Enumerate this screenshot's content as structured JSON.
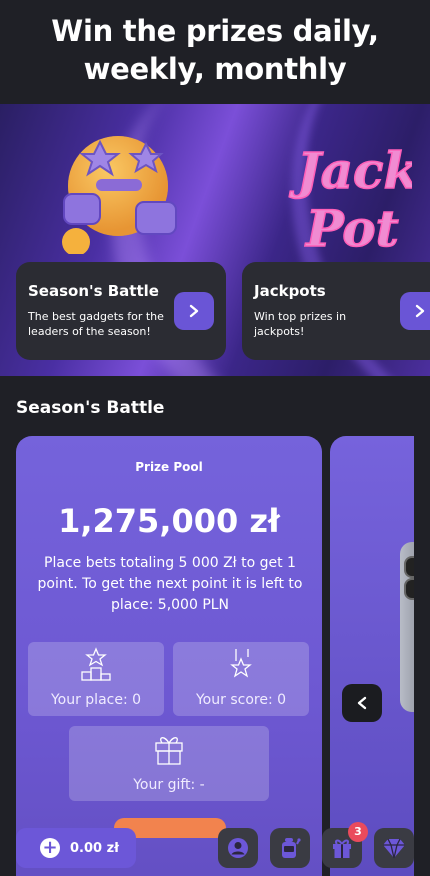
{
  "header": {
    "title": "Win the prizes daily, weekly, monthly"
  },
  "promos": [
    {
      "title": "Season's Battle",
      "description": "The best gadgets for the leaders of the season!",
      "icon": "chevron-right-icon"
    },
    {
      "title": "Jackpots",
      "description": "Win top prizes in jackpots!",
      "icon": "chevron-right-icon",
      "art_text": "Jack Pot"
    }
  ],
  "battle": {
    "heading": "Season's Battle",
    "prize_pool_label": "Prize Pool",
    "prize_amount": "1,275,000 zł",
    "description": "Place bets totaling 5 000 Zł to get 1 point. To get the next point it is left to place: 5,000 PLN",
    "place_label": "Your place: 0",
    "score_label": "Your score: 0",
    "gift_label": "Your gift: -"
  },
  "bottom_bar": {
    "balance": "0.00 zł",
    "gifts_badge": "3"
  },
  "colors": {
    "background": "#1f2026",
    "accent": "#6c57d8",
    "card": "#2b2c33",
    "badge": "#ea4b5c"
  }
}
